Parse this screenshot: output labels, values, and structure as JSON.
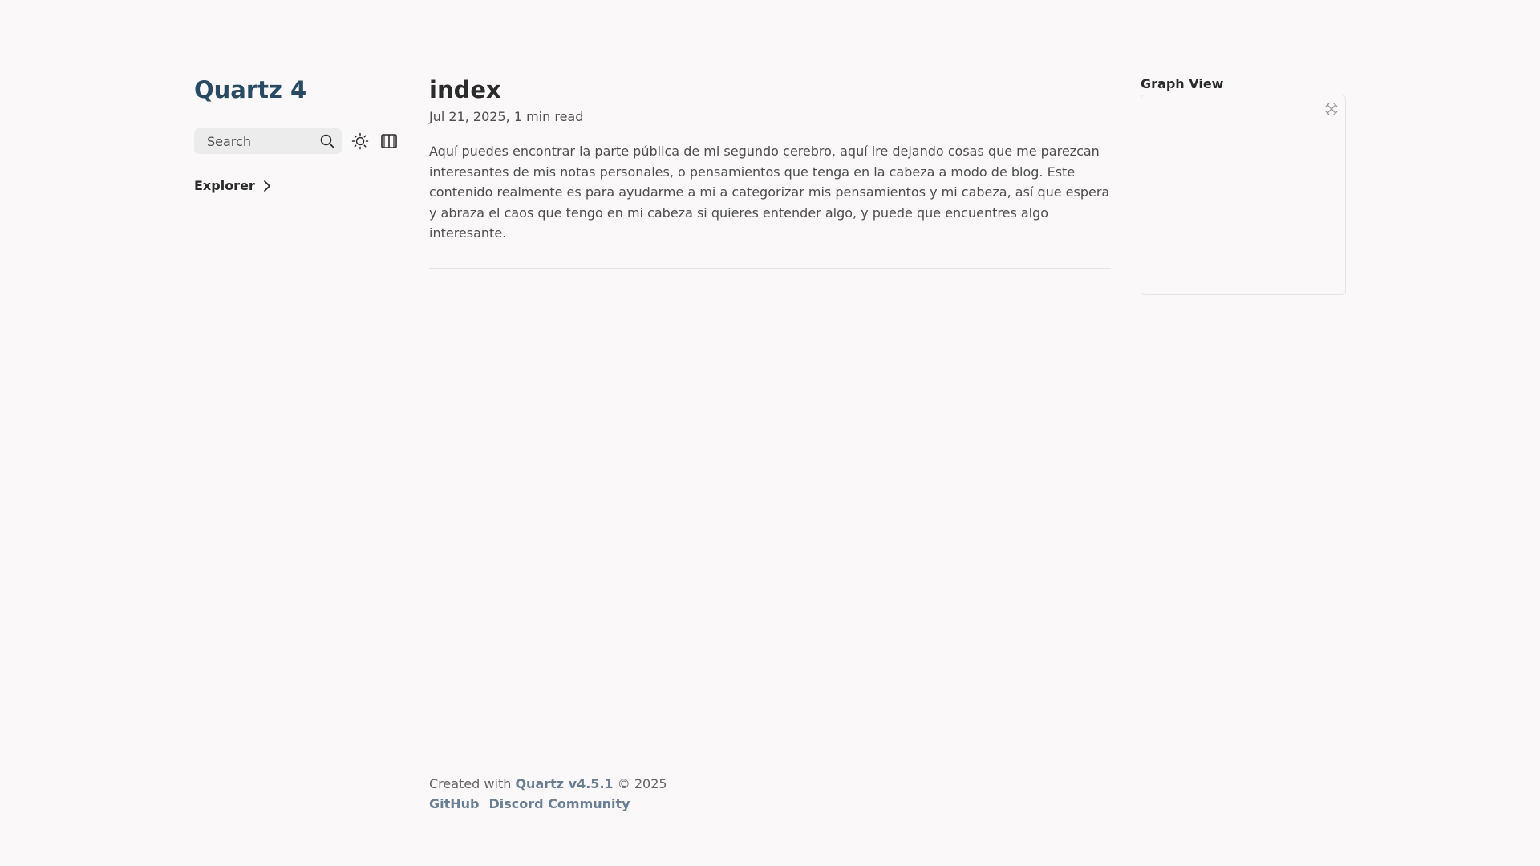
{
  "sidebar": {
    "site_title": "Quartz 4",
    "search_placeholder": "Search",
    "explorer_label": "Explorer"
  },
  "article": {
    "title": "index",
    "date": "Jul 21, 2025",
    "read_time": "1 min read",
    "body": "Aquí puedes encontrar la parte pública de mi segundo cerebro, aquí ire dejando cosas que me parezcan interesantes de mis notas personales, o pensamientos que tenga en la cabeza a modo de blog. Este contenido realmente es para ayudarme a mi a categorizar mis pensamientos y mi cabeza, así que espera y abraza el caos que tengo en mi cabeza si quieres entender algo, y puede que encuentres algo interesante."
  },
  "graph": {
    "title": "Graph View"
  },
  "footer": {
    "created_prefix": "Created with",
    "quartz_link": "Quartz v4.5.1",
    "copyright": "© 2025",
    "links": [
      "GitHub",
      "Discord Community"
    ]
  },
  "colors": {
    "background": "#faf8f8",
    "title_accent": "#284b63",
    "link": "#6b7f93",
    "text": "#4e4e4e"
  },
  "icons": {
    "search": "search-icon",
    "theme": "sun-icon",
    "reader": "book-icon",
    "explorer": "chevron-right-icon",
    "graph_expand": "expand-icon"
  }
}
